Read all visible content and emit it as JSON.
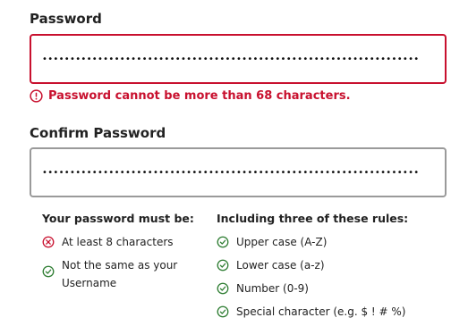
{
  "password": {
    "label": "Password",
    "value_masked": "••••••••••••••••••••••••••••••••••••••••••••••••••••••••••••••••••••",
    "error": "Password cannot be more than 68 characters."
  },
  "confirm_password": {
    "label": "Confirm Password",
    "value_masked": "••••••••••••••••••••••••••••••••••••••••••••••••••••••••••••••••••••"
  },
  "requirements": {
    "must_be": {
      "title": "Your password must be:",
      "items": [
        {
          "text": "At least 8 characters",
          "status": "fail",
          "icon": "x-circle-icon"
        },
        {
          "text": "Not the same as your Username",
          "status": "pass",
          "icon": "check-circle-icon"
        }
      ]
    },
    "rules": {
      "title": "Including three of these rules:",
      "items": [
        {
          "text": "Upper case (A-Z)",
          "status": "pass",
          "icon": "check-circle-icon"
        },
        {
          "text": "Lower case (a-z)",
          "status": "pass",
          "icon": "check-circle-icon"
        },
        {
          "text": "Number (0-9)",
          "status": "pass",
          "icon": "check-circle-icon"
        },
        {
          "text": "Special character (e.g. $ ! # %)",
          "status": "pass",
          "icon": "check-circle-icon"
        }
      ]
    }
  },
  "colors": {
    "error": "#c8102e",
    "success": "#2e7d32",
    "border_default": "#9a9a9a"
  }
}
